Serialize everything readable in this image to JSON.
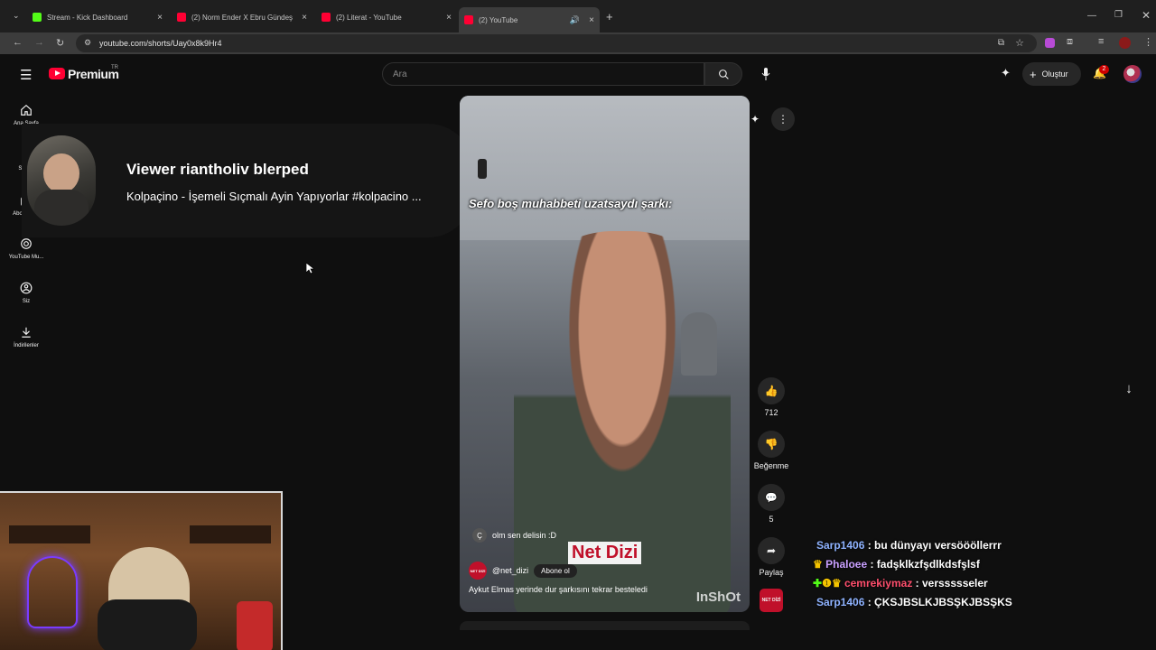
{
  "browser": {
    "tabs": [
      {
        "title": "Stream - Kick Dashboard",
        "favicon_color": "#53fc18"
      },
      {
        "title": "(2) Norm Ender X Ebru Gündeş",
        "favicon_color": "#ff0033"
      },
      {
        "title": "(2) Literat - YouTube",
        "favicon_color": "#ff0033"
      },
      {
        "title": "(2) YouTube",
        "favicon_color": "#ff0033"
      }
    ],
    "url": "youtube.com/shorts/Uay0x8k9Hr4"
  },
  "header": {
    "logo_text": "Premium",
    "logo_sup": "TR",
    "search_placeholder": "Ara",
    "create_label": "Oluştur",
    "notif_count": "2"
  },
  "sidebar": {
    "items": [
      {
        "label": "Ana Sayfa",
        "icon": "home-icon"
      },
      {
        "label": "Shorts",
        "icon": "shorts-icon"
      },
      {
        "label": "Abonelikler",
        "icon": "subscriptions-icon"
      },
      {
        "label": "YouTube Mu...",
        "icon": "music-icon"
      },
      {
        "label": "Siz",
        "icon": "user-icon"
      },
      {
        "label": "İndirilenler",
        "icon": "download-icon"
      }
    ]
  },
  "overlay": {
    "title": "Viewer riantholiv blerped",
    "subtitle": "Kolpaçino - İşemeli Sıçmalı Ayin Yapıyorlar #kolpacino ..."
  },
  "short": {
    "caption": "Sefo boş muhabbeti uzatsaydı şarkı:",
    "comment_initial": "Ç",
    "comment": "olm sen delisin :D",
    "brand_overlay": "Net Dizi",
    "channel": "@net_dizi",
    "subscribe_label": "Abone ol",
    "description": "Aykut Elmas yerinde dur şarkısını tekrar besteledi",
    "watermark": "InShOt",
    "channel_badge": "NET DİZİ"
  },
  "actions": {
    "likes": "712",
    "dislike_label": "Beğenme",
    "comments": "5",
    "share_label": "Paylaş"
  },
  "chat": [
    {
      "user": "Sarp1406",
      "message": " : bu dünyayı versöööllerrr",
      "color": "#8fb3ff"
    },
    {
      "user": "Phaloee",
      "message": " : fadşklkzfşdlkdsfşlsf",
      "color": "#c9a0ff"
    },
    {
      "user": "cemrekiymaz",
      "message": " : verssssseler",
      "color": "#ff4f6d"
    },
    {
      "user": "Sarp1406",
      "message": " : ÇKSJBSLKJBSŞKJBSŞKS",
      "color": "#8fb3ff"
    }
  ],
  "colors": {
    "youtube_red": "#ff0033",
    "background": "#0f0f0f"
  }
}
